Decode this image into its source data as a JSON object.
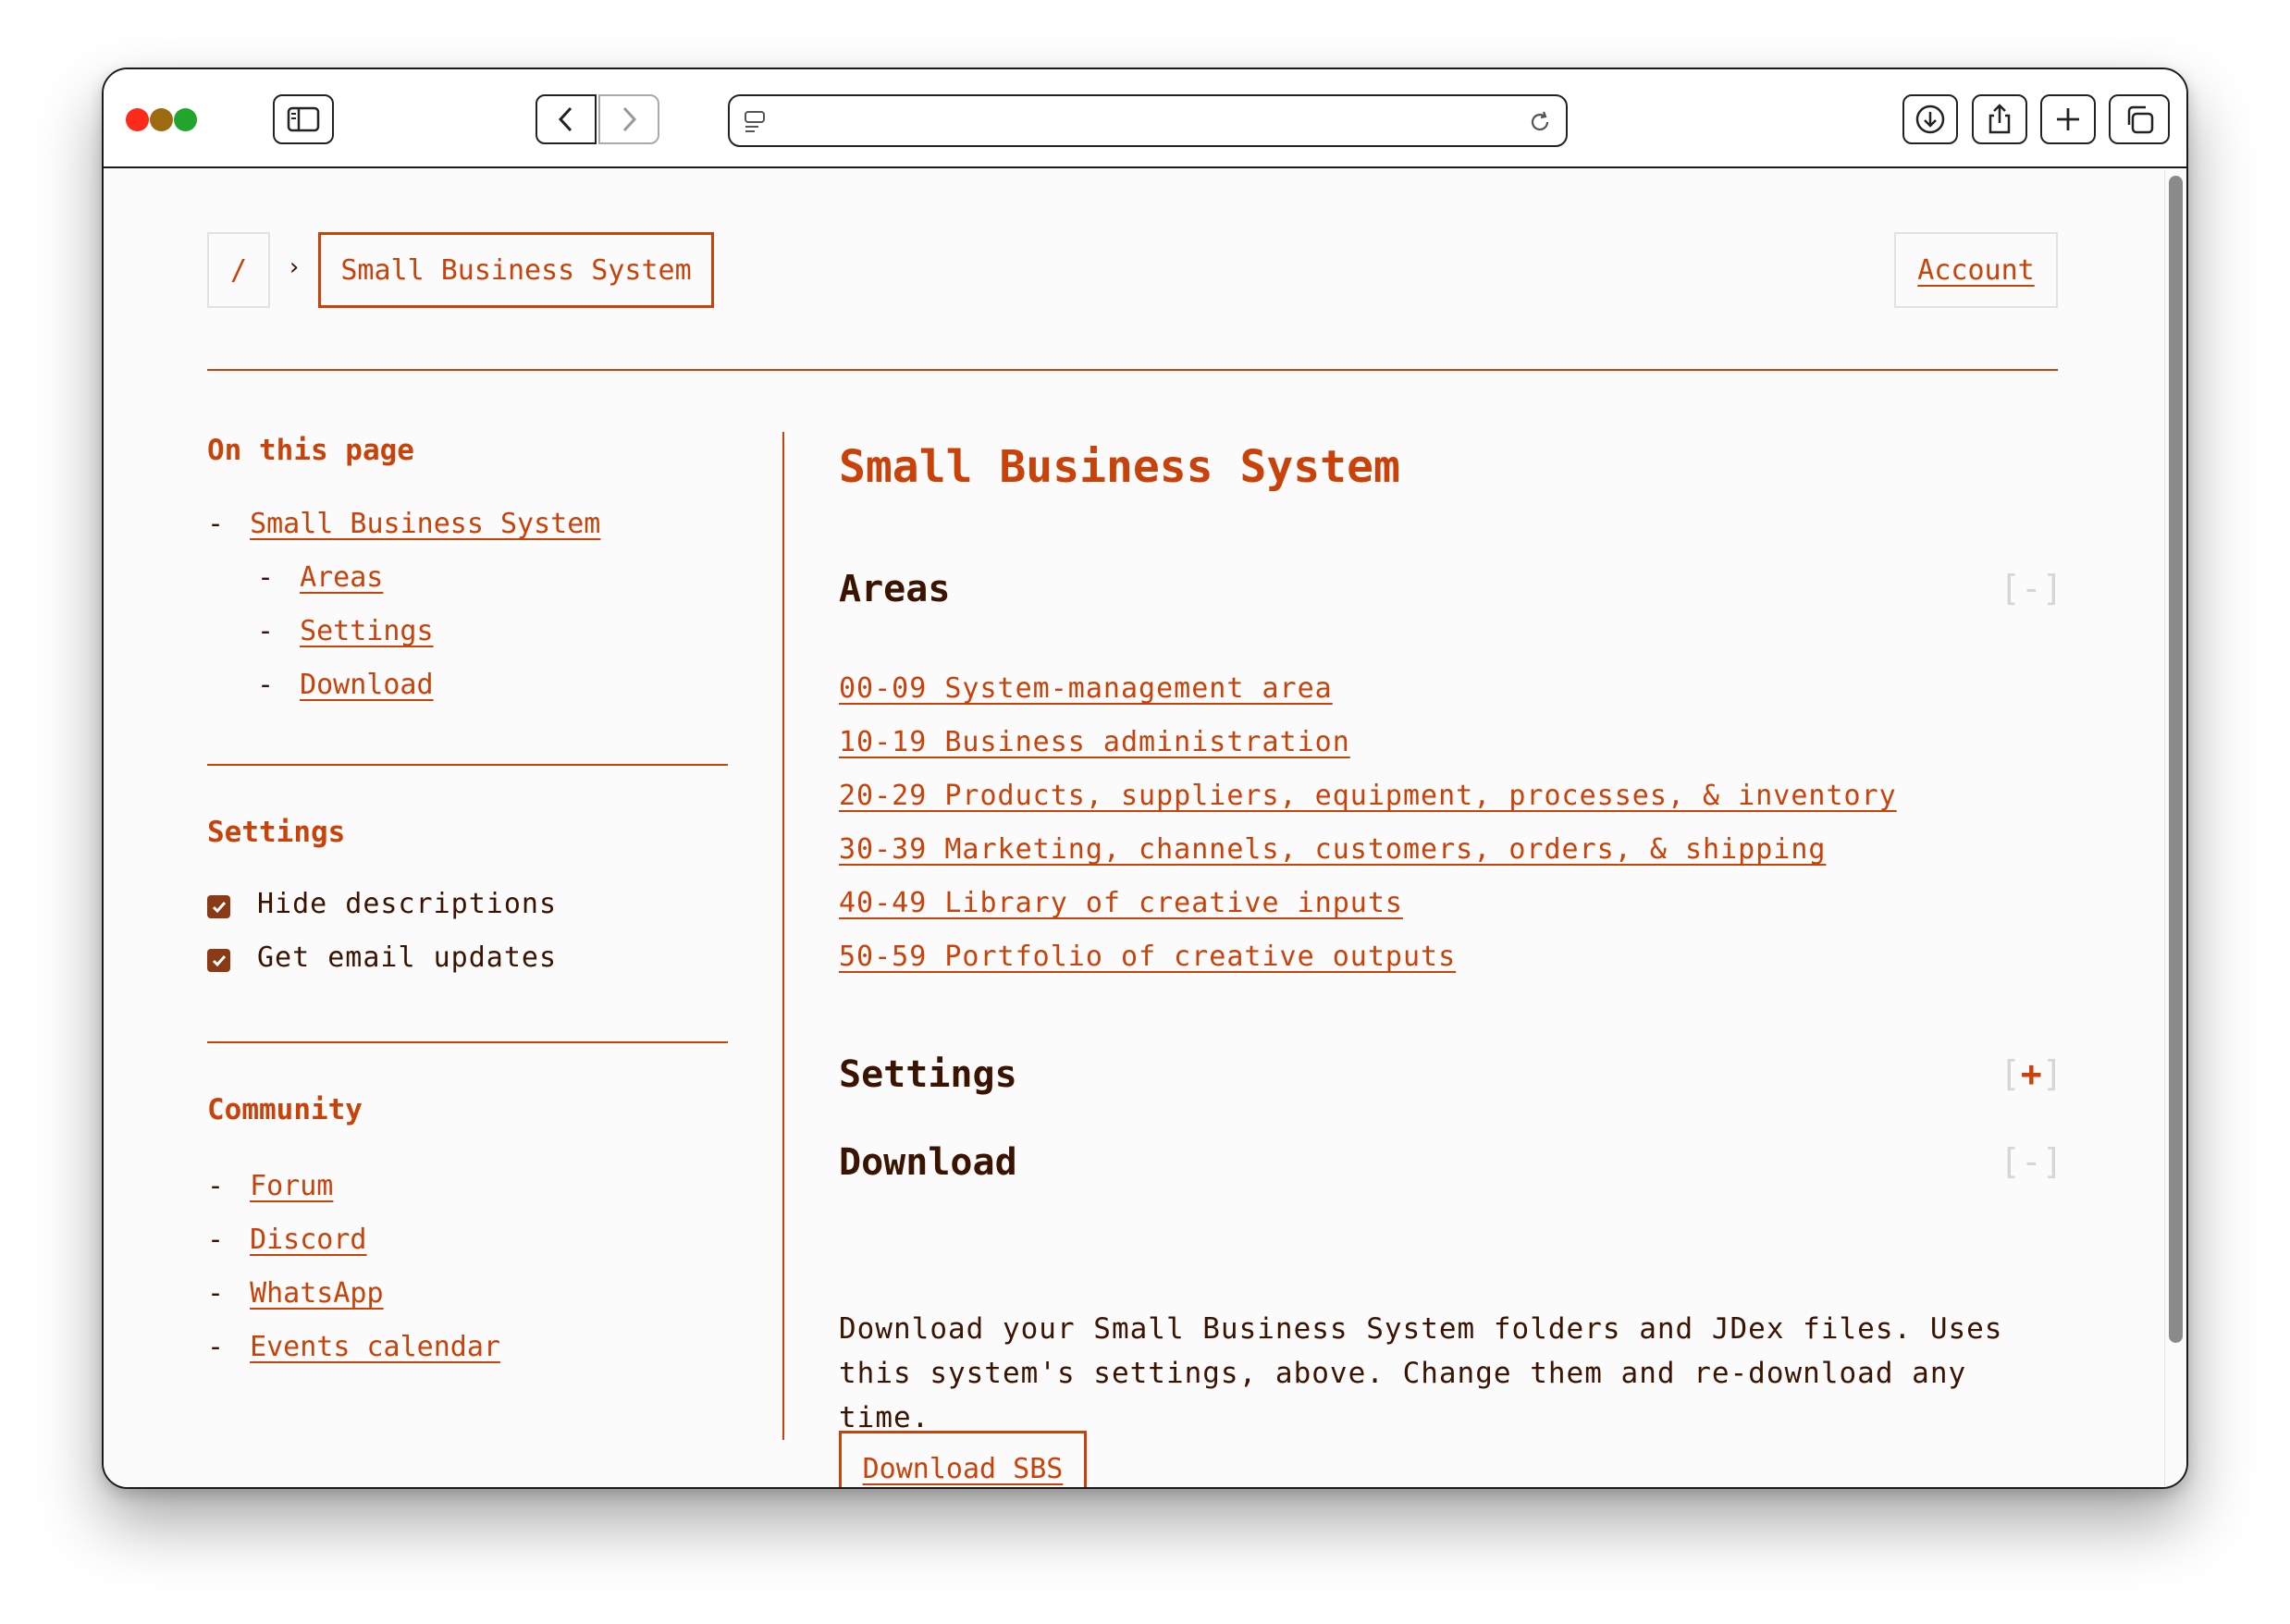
{
  "breadcrumb": {
    "root": "/",
    "separator": "›",
    "current": "Small Business System"
  },
  "header": {
    "account_label": "Account"
  },
  "sidebar": {
    "on_this_page": {
      "heading": "On this page",
      "items": [
        {
          "label": "Small Business System"
        },
        {
          "label": "Areas"
        },
        {
          "label": "Settings"
        },
        {
          "label": "Download"
        }
      ]
    },
    "settings": {
      "heading": "Settings",
      "options": [
        {
          "label": "Hide descriptions",
          "checked": true
        },
        {
          "label": "Get email updates",
          "checked": true
        }
      ]
    },
    "community": {
      "heading": "Community",
      "links": [
        {
          "label": "Forum"
        },
        {
          "label": "Discord"
        },
        {
          "label": "WhatsApp"
        },
        {
          "label": "Events calendar"
        }
      ]
    }
  },
  "main": {
    "title": "Small Business System",
    "areas": {
      "heading": "Areas",
      "toggle_open": "[",
      "toggle_symbol": "-",
      "toggle_close": "]",
      "links": [
        "00-09 System-management area",
        "10-19 Business administration",
        "20-29 Products, suppliers, equipment, processes, & inventory",
        "30-39 Marketing, channels, customers, orders, & shipping",
        "40-49 Library of creative inputs",
        "50-59 Portfolio of creative outputs"
      ]
    },
    "settings": {
      "heading": "Settings",
      "toggle_open": "[",
      "toggle_symbol": "+",
      "toggle_close": "]"
    },
    "download": {
      "heading": "Download",
      "toggle_open": "[",
      "toggle_symbol": "-",
      "toggle_close": "]",
      "description": "Download your Small Business System folders and JDex files. Uses this system's settings, above. Change them and re-download any time.",
      "button_label": "Download SBS"
    }
  },
  "colors": {
    "accent": "#c8420a",
    "text": "#3a1400",
    "checkbox": "#8a3a14"
  }
}
